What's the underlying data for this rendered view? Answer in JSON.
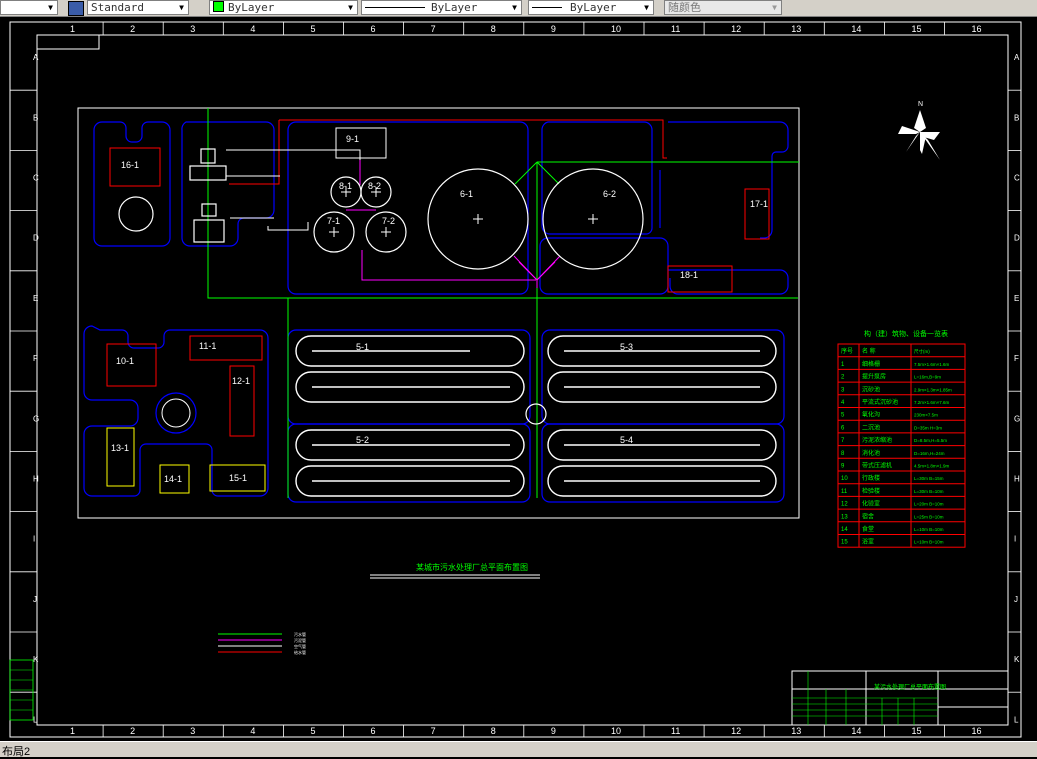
{
  "toolbar": {
    "text_style": "Standard",
    "color": "ByLayer",
    "linetype": "ByLayer",
    "lineweight": "ByLayer",
    "plot_style": "随颜色"
  },
  "status": {
    "tab_label": "布局2"
  },
  "colors": {
    "background": "#000000",
    "frame": "#ffffff",
    "green": "#00ff00",
    "blue": "#0000ff",
    "red": "#ff0000",
    "magenta": "#ff00ff",
    "yellow": "#ffff00"
  },
  "drawing": {
    "columns": [
      "1",
      "2",
      "3",
      "4",
      "5",
      "6",
      "7",
      "8",
      "9",
      "10",
      "11",
      "12",
      "13",
      "14",
      "15",
      "16"
    ],
    "rows": [
      "A",
      "B",
      "C",
      "D",
      "E",
      "F",
      "G",
      "H",
      "I",
      "J",
      "K",
      "L"
    ],
    "title": "某城市污水处理厂总平面布置图",
    "north": "N",
    "units": [
      "16-1",
      "9-1",
      "8-1",
      "8-2",
      "7-1",
      "7-2",
      "6-1",
      "6-2",
      "17-1",
      "18-1",
      "5-1",
      "5-3",
      "5-2",
      "5-4",
      "10-1",
      "11-1",
      "12-1",
      "13-1",
      "14-1",
      "15-1"
    ],
    "legend": [
      "污水管",
      "污泥管",
      "空气管",
      "给水管"
    ],
    "table": {
      "title": "构（建）筑物、设备一览表",
      "headers": [
        "序号",
        "名 称",
        "尺寸(m)"
      ],
      "rows": [
        [
          "1",
          "细格栅",
          "7.5m×1.6m×1.6m"
        ],
        [
          "2",
          "提升泵房",
          "L=16m,B=9m"
        ],
        [
          "3",
          "沉砂池",
          "2.9m×1.3m×1.85m"
        ],
        [
          "4",
          "平流式沉砂池",
          "7.2m×1.6m×7.6m"
        ],
        [
          "5",
          "氧化沟",
          "230m×7.5m"
        ],
        [
          "6",
          "二沉池",
          "D=35m H=3m"
        ],
        [
          "7",
          "污泥浓缩池",
          "D=8.5m,H=5.5m"
        ],
        [
          "8",
          "消化池",
          "D=16m,H=24m"
        ],
        [
          "9",
          "带式压滤机",
          "4.5m×1.8m×1.9m"
        ],
        [
          "10",
          "行政楼",
          "L=30m B=15m"
        ],
        [
          "11",
          "检验楼",
          "L=30m B=10m"
        ],
        [
          "12",
          "化验室",
          "L=20m B=10m"
        ],
        [
          "13",
          "宿舍",
          "L=25m B=10m"
        ],
        [
          "14",
          "食堂",
          "L=10m B=10m"
        ],
        [
          "15",
          "浴室",
          "L=10m B=10m"
        ]
      ]
    },
    "titleblock": {
      "name": "某污水处理厂总平面布置图"
    }
  }
}
